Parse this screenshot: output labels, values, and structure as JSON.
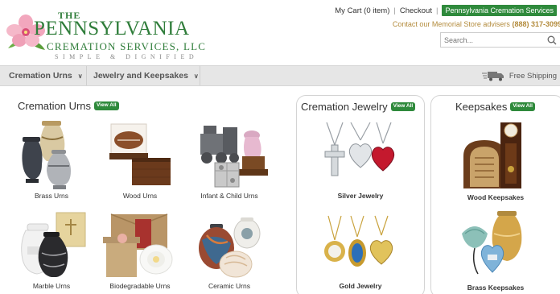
{
  "header": {
    "logo": {
      "the": "THE",
      "name": "PENNSYLVANIA",
      "sub": "CREMATION SERVICES, LLC",
      "tagline": "SIMPLE & DIGNIFIED"
    },
    "cart_label": "My Cart (0 item)",
    "checkout_label": "Checkout",
    "pcs_button_label": "Pennsylvania Cremation Services",
    "contact_prefix": "Contact our Memorial Store advisers",
    "contact_phone": "(888) 317-3099",
    "search": {
      "placeholder": "Search..."
    }
  },
  "nav": {
    "items": [
      {
        "label": "Cremation Urns"
      },
      {
        "label": "Jewelry and Keepsakes"
      }
    ],
    "free_shipping_label": "Free Shipping"
  },
  "sections": {
    "urns": {
      "title": "Cremation Urns",
      "view_all": "View All",
      "tiles": [
        {
          "label": "Brass Urns"
        },
        {
          "label": "Wood Urns"
        },
        {
          "label": "Infant & Child Urns"
        },
        {
          "label": "Marble Urns"
        },
        {
          "label": "Biodegradable Urns"
        },
        {
          "label": "Ceramic Urns"
        }
      ]
    },
    "jewelry": {
      "title": "Cremation Jewelry",
      "view_all": "View All",
      "tiles": [
        {
          "label": "Silver Jewelry"
        },
        {
          "label": "Gold Jewelry"
        }
      ]
    },
    "keepsakes": {
      "title": "Keepsakes",
      "view_all": "View All",
      "tiles": [
        {
          "label": "Wood Keepsakes"
        },
        {
          "label": "Brass Keepsakes"
        }
      ]
    }
  },
  "colors": {
    "brand_green": "#2f7d3a",
    "button_green": "#2f8a3c",
    "contact_gold": "#b38b3c",
    "nav_bg": "#e6e6e6"
  }
}
